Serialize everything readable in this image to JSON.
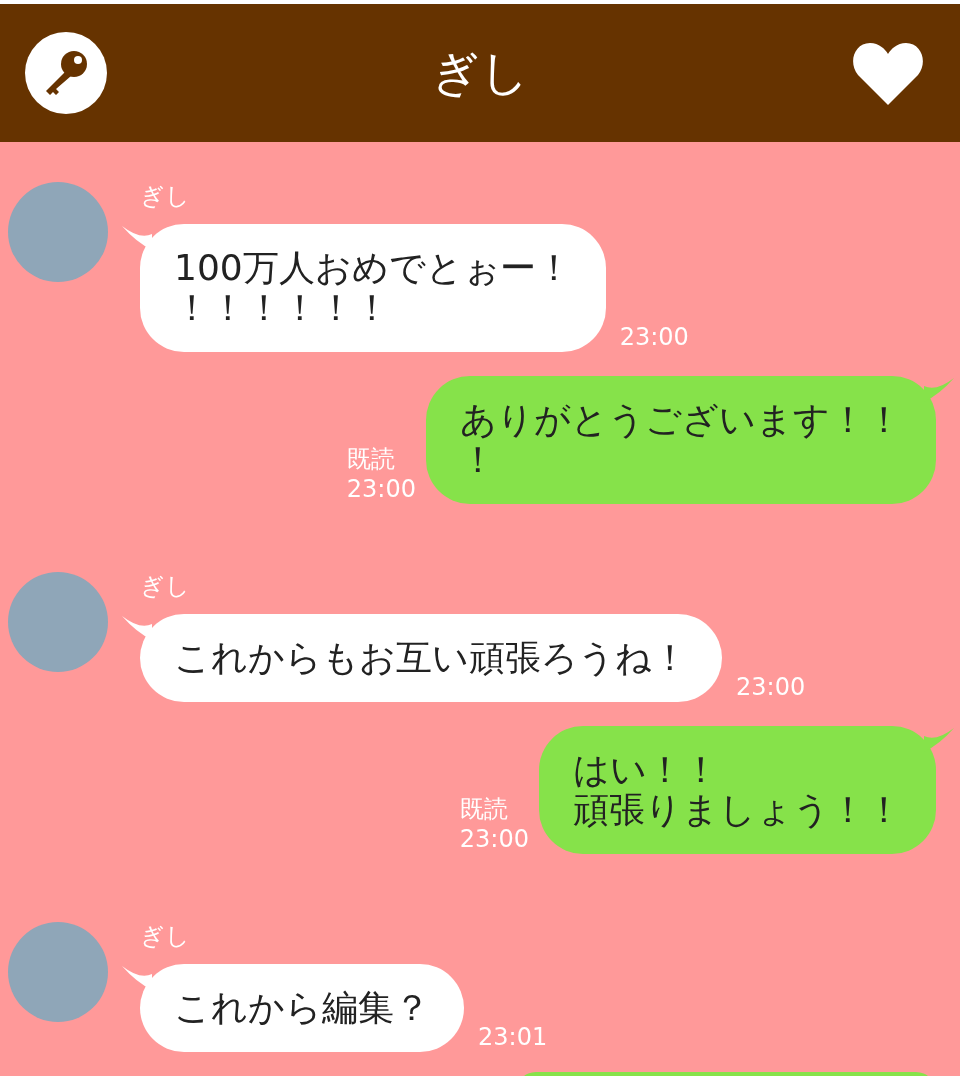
{
  "header": {
    "title": "ぎし"
  },
  "messages": [
    {
      "kind": "received",
      "name": "ぎし",
      "lines": [
        "100万人おめでとぉー！",
        "！！！！！！"
      ],
      "time": "23:00"
    },
    {
      "kind": "sent",
      "lines": [
        "ありがとうございます！！",
        "！"
      ],
      "read": "既読",
      "time": "23:00"
    },
    {
      "kind": "received",
      "name": "ぎし",
      "lines": [
        "これからもお互い頑張ろうね！"
      ],
      "time": "23:00"
    },
    {
      "kind": "sent",
      "lines": [
        "はい！！",
        "頑張りましょう！！"
      ],
      "read": "既読",
      "time": "23:00"
    },
    {
      "kind": "received",
      "name": "ぎし",
      "lines": [
        "これから編集？"
      ],
      "time": "23:01"
    },
    {
      "kind": "sent"
    }
  ]
}
